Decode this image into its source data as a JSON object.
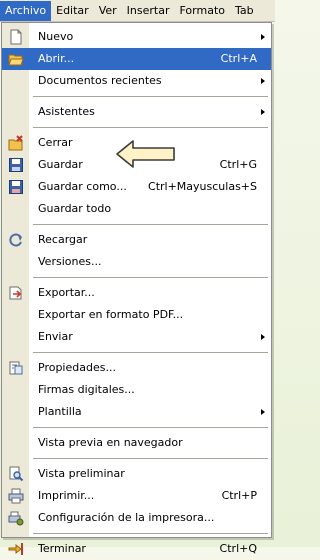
{
  "menubar": {
    "items": [
      "Archivo",
      "Editar",
      "Ver",
      "Insertar",
      "Formato",
      "Tab"
    ]
  },
  "menu": {
    "items": [
      {
        "label": "Nuevo",
        "shortcut": "",
        "submenu": true,
        "icon": "new-document-icon"
      },
      {
        "label": "Abrir...",
        "shortcut": "Ctrl+A",
        "submenu": false,
        "icon": "open-folder-icon",
        "selected": true
      },
      {
        "label": "Documentos recientes",
        "shortcut": "",
        "submenu": true,
        "icon": ""
      },
      {
        "label": "Asistentes",
        "shortcut": "",
        "submenu": true,
        "icon": ""
      },
      {
        "label": "Cerrar",
        "shortcut": "",
        "submenu": false,
        "icon": "close-document-icon"
      },
      {
        "label": "Guardar",
        "shortcut": "Ctrl+G",
        "submenu": false,
        "icon": "save-icon"
      },
      {
        "label": "Guardar como...",
        "shortcut": "Ctrl+Mayusculas+S",
        "submenu": false,
        "icon": "save-as-icon"
      },
      {
        "label": "Guardar todo",
        "shortcut": "",
        "submenu": false,
        "icon": ""
      },
      {
        "label": "Recargar",
        "shortcut": "",
        "submenu": false,
        "icon": "reload-icon"
      },
      {
        "label": "Versiones...",
        "shortcut": "",
        "submenu": false,
        "icon": ""
      },
      {
        "label": "Exportar...",
        "shortcut": "",
        "submenu": false,
        "icon": "export-icon"
      },
      {
        "label": "Exportar en formato PDF...",
        "shortcut": "",
        "submenu": false,
        "icon": ""
      },
      {
        "label": "Enviar",
        "shortcut": "",
        "submenu": true,
        "icon": ""
      },
      {
        "label": "Propiedades...",
        "shortcut": "",
        "submenu": false,
        "icon": "properties-icon"
      },
      {
        "label": "Firmas digitales...",
        "shortcut": "",
        "submenu": false,
        "icon": ""
      },
      {
        "label": "Plantilla",
        "shortcut": "",
        "submenu": true,
        "icon": ""
      },
      {
        "label": "Vista previa en navegador",
        "shortcut": "",
        "submenu": false,
        "icon": ""
      },
      {
        "label": "Vista preliminar",
        "shortcut": "",
        "submenu": false,
        "icon": "print-preview-icon"
      },
      {
        "label": "Imprimir...",
        "shortcut": "Ctrl+P",
        "submenu": false,
        "icon": "print-icon"
      },
      {
        "label": "Configuración de la impresora...",
        "shortcut": "",
        "submenu": false,
        "icon": "printer-settings-icon"
      },
      {
        "label": "Terminar",
        "shortcut": "Ctrl+Q",
        "submenu": false,
        "icon": "exit-icon"
      }
    ]
  },
  "colors": {
    "selection": "#316ac5",
    "arrow_fill": "#fff2c6",
    "arrow_stroke": "#3b3b3b"
  }
}
